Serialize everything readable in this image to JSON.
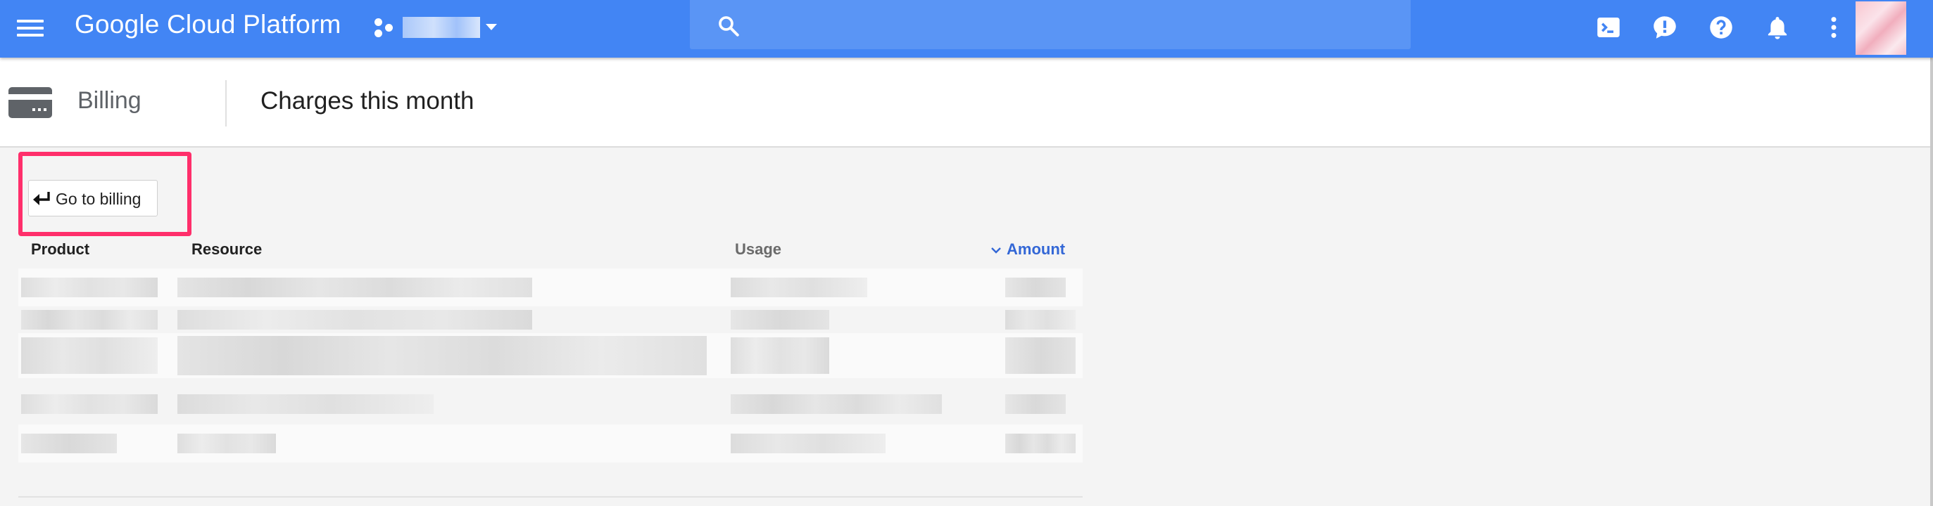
{
  "topbar": {
    "brand": "Google Cloud Platform",
    "search_placeholder": "",
    "icons": [
      "menu-icon",
      "project-dots-icon",
      "search-icon",
      "cloud-shell-icon",
      "feedback-icon",
      "help-icon",
      "notifications-icon",
      "more-vert-icon"
    ]
  },
  "header": {
    "section": "Billing",
    "title": "Charges this month"
  },
  "main": {
    "go_to_billing_label": "Go to billing"
  },
  "table": {
    "columns": [
      "Product",
      "Resource",
      "Usage",
      "Amount"
    ],
    "sorted_column": "Amount"
  },
  "colors": {
    "app_bar": "#4285f4",
    "highlight": "#ff2f6b",
    "sorted_header": "#3367d6"
  }
}
